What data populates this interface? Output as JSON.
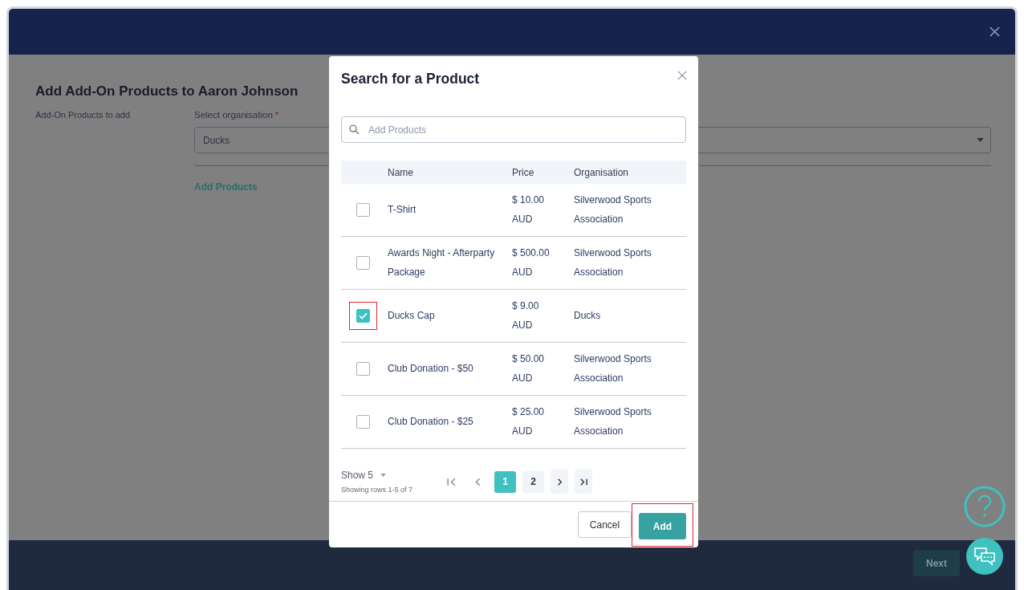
{
  "page": {
    "title": "Add Add-On Products to Aaron Johnson",
    "section_label": "Add-On Products to add",
    "org_label": "Select organisation",
    "required_mark": "*",
    "org_value": "Ducks",
    "add_products_link": "Add Products",
    "next_button": "Next"
  },
  "modal": {
    "title": "Search for a Product",
    "search": {
      "placeholder": "Add Products"
    },
    "columns": [
      "Name",
      "Price",
      "Organisation"
    ],
    "rows": [
      {
        "name": "T-Shirt",
        "price": "$ 10.00 AUD",
        "organisation": "Silverwood Sports Association",
        "checked": false,
        "highlighted": false
      },
      {
        "name": "Awards Night - Afterparty Package",
        "price": "$ 500.00 AUD",
        "organisation": "Silverwood Sports Association",
        "checked": false,
        "highlighted": false
      },
      {
        "name": "Ducks Cap",
        "price": "$ 9.00 AUD",
        "organisation": "Ducks",
        "checked": true,
        "highlighted": true
      },
      {
        "name": "Club Donation - $50",
        "price": "$ 50.00 AUD",
        "organisation": "Silverwood Sports Association",
        "checked": false,
        "highlighted": false
      },
      {
        "name": "Club Donation - $25",
        "price": "$ 25.00 AUD",
        "organisation": "Silverwood Sports Association",
        "checked": false,
        "highlighted": false
      }
    ],
    "pagination": {
      "show": "Show 5",
      "summary": "Showing rows 1-5 of 7",
      "pages": [
        {
          "label": "1",
          "selected": true
        },
        {
          "label": "2",
          "selected": false
        }
      ]
    },
    "cancel_button": "Cancel",
    "add_button": {
      "label": "Add",
      "highlighted": true
    }
  }
}
